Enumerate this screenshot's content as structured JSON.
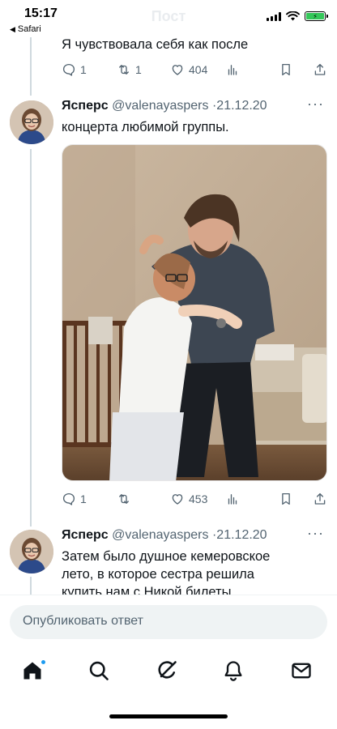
{
  "status_bar": {
    "time": "15:17",
    "back_label": "Safari",
    "ghost_title": "Пост",
    "battery_color": "#34c759"
  },
  "tweets": [
    {
      "text_tail": "Я чувствовала себя как после",
      "replies": "1",
      "retweets": "1",
      "likes": "404"
    },
    {
      "name": "Ясперс",
      "handle": "@valenayaspers",
      "date": "21.12.20",
      "separator": "·",
      "text": "концерта любимой группы.",
      "replies": "1",
      "retweets": "",
      "likes": "453",
      "photo_description": "photo"
    },
    {
      "name": "Ясперс",
      "handle": "@valenayaspers",
      "date": "21.12.20",
      "separator": "·",
      "text_line1": "Затем было душное кемеровское",
      "text_line2": "лето, в которое сестра решила",
      "text_line3": "купить нам с Никой билеты"
    }
  ],
  "more_label": "···",
  "reply": {
    "placeholder": "Опубликовать ответ"
  },
  "tabs": [
    "home-icon",
    "search-icon",
    "grok-icon",
    "notifications-icon",
    "messages-icon"
  ],
  "colors": {
    "accent": "#1d9bf0",
    "text": "#0f1419",
    "muted": "#536471"
  }
}
